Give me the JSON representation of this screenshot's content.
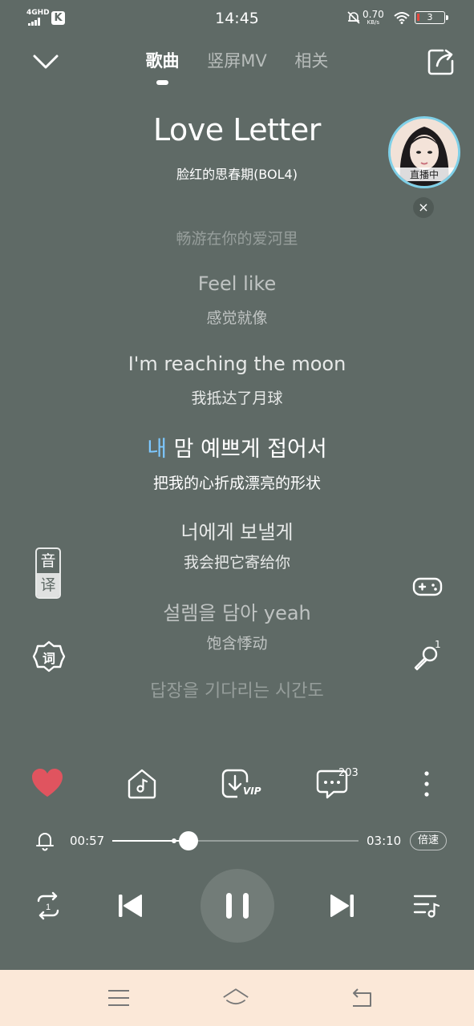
{
  "status_bar": {
    "network": "4GHD",
    "app_badge": "K",
    "time": "14:45",
    "speed_value": "0.70",
    "speed_unit": "KB/s",
    "battery": "3"
  },
  "header": {
    "tabs": [
      {
        "label": "歌曲",
        "active": true
      },
      {
        "label": "竖屏MV",
        "active": false
      },
      {
        "label": "相关",
        "active": false
      }
    ]
  },
  "song": {
    "title": "Love Letter",
    "artist": "脸红的思春期(BOL4)"
  },
  "live": {
    "badge": "直播中",
    "close": "×"
  },
  "lyrics": {
    "prev_tail": "畅游在你的爱河里",
    "line1_text": "Feel like",
    "line1_trans": "感觉就像",
    "line2_text": "I'm reaching the moon",
    "line2_trans": "我抵达了月球",
    "current_sung": "내",
    "current_rest": " 맘 예쁘게 접어서",
    "current_trans": "把我的心折成漂亮的形状",
    "line4_text": "너에게 보낼게",
    "line4_trans": "我会把它寄给你",
    "line5_text": "설렘을 담아 yeah",
    "line5_trans": "饱含悸动",
    "line6_text": "답장을 기다리는 시간도"
  },
  "side": {
    "yin": "音",
    "yi": "译",
    "ci": "词",
    "mic_badge": "1"
  },
  "actions": {
    "comment_count": "203",
    "vip_label": "VIP"
  },
  "progress": {
    "current": "00:57",
    "total": "03:10",
    "fraction": 0.31,
    "speed_label": "倍速"
  },
  "colors": {
    "background": "#5f6a66",
    "heart": "#e0545f",
    "lyric_highlight": "#7dc8ff",
    "navbar": "#fbe8d8"
  }
}
